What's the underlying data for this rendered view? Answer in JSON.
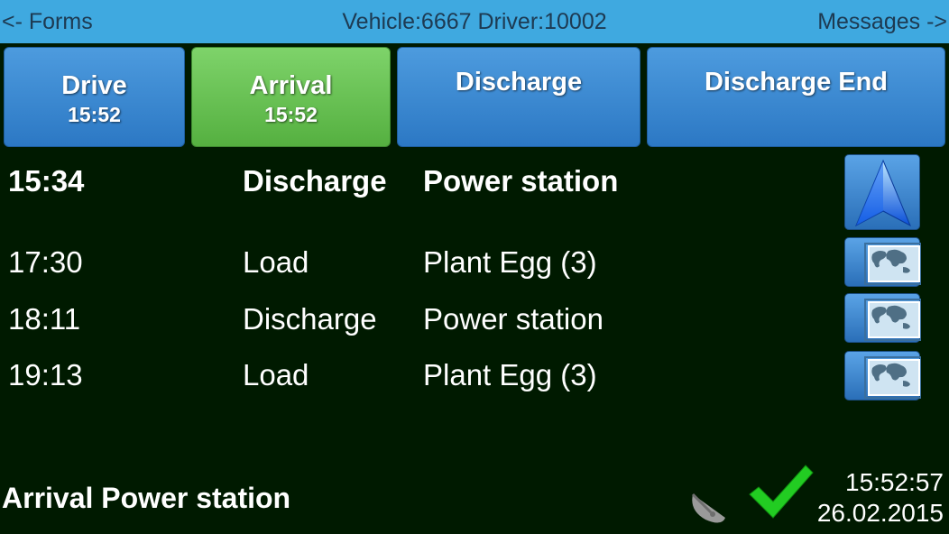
{
  "header": {
    "nav_left": "<- Forms",
    "title": "Vehicle:6667 Driver:10002",
    "nav_right": "Messages ->"
  },
  "tabs": [
    {
      "label": "Drive",
      "time": "15:52",
      "active": false
    },
    {
      "label": "Arrival",
      "time": "15:52",
      "active": true
    },
    {
      "label": "Discharge",
      "time": "",
      "active": false
    },
    {
      "label": "Discharge End",
      "time": "",
      "active": false
    }
  ],
  "stops": [
    {
      "time": "15:34",
      "type": "Discharge",
      "place": "Power station",
      "icon": "navigation-arrow-icon",
      "current": true
    },
    {
      "time": "17:30",
      "type": "Load",
      "place": "Plant Egg (3)",
      "icon": "world-map-icon",
      "current": false
    },
    {
      "time": "18:11",
      "type": "Discharge",
      "place": "Power station",
      "icon": "world-map-icon",
      "current": false
    },
    {
      "time": "19:13",
      "type": "Load",
      "place": "Plant Egg (3)",
      "icon": "world-map-icon",
      "current": false
    }
  ],
  "footer": {
    "status": "Arrival Power station",
    "clock_time": "15:52:57",
    "clock_date": "26.02.2015",
    "icons": [
      "satellite-dish-icon",
      "checkmark-icon"
    ]
  },
  "colors": {
    "background": "#001a00",
    "header": "#3fa9e0",
    "tab": "#3b89d2",
    "tab_active": "#66c052",
    "check": "#22cc22"
  }
}
